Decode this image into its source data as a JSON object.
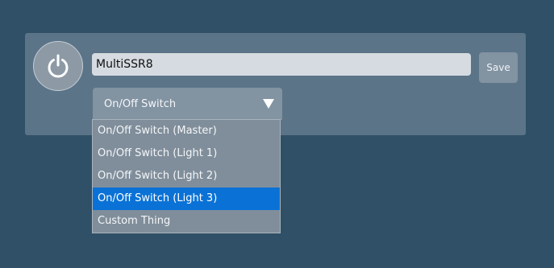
{
  "device": {
    "name_value": "MultiSSR8",
    "save_label": "Save",
    "power_icon": "power-icon"
  },
  "thing_type": {
    "selected": "On/Off Switch",
    "options": [
      "On/Off Switch  (Master)",
      "On/Off Switch  (Light 1)",
      "On/Off Switch  (Light 2)",
      "On/Off Switch  (Light 3)",
      "Custom Thing"
    ],
    "highlighted_option": "On/Off Switch  (Light 3)"
  },
  "colors": {
    "background": "#2f5066",
    "panel": "#5c7488",
    "highlight": "#0a72d6"
  }
}
